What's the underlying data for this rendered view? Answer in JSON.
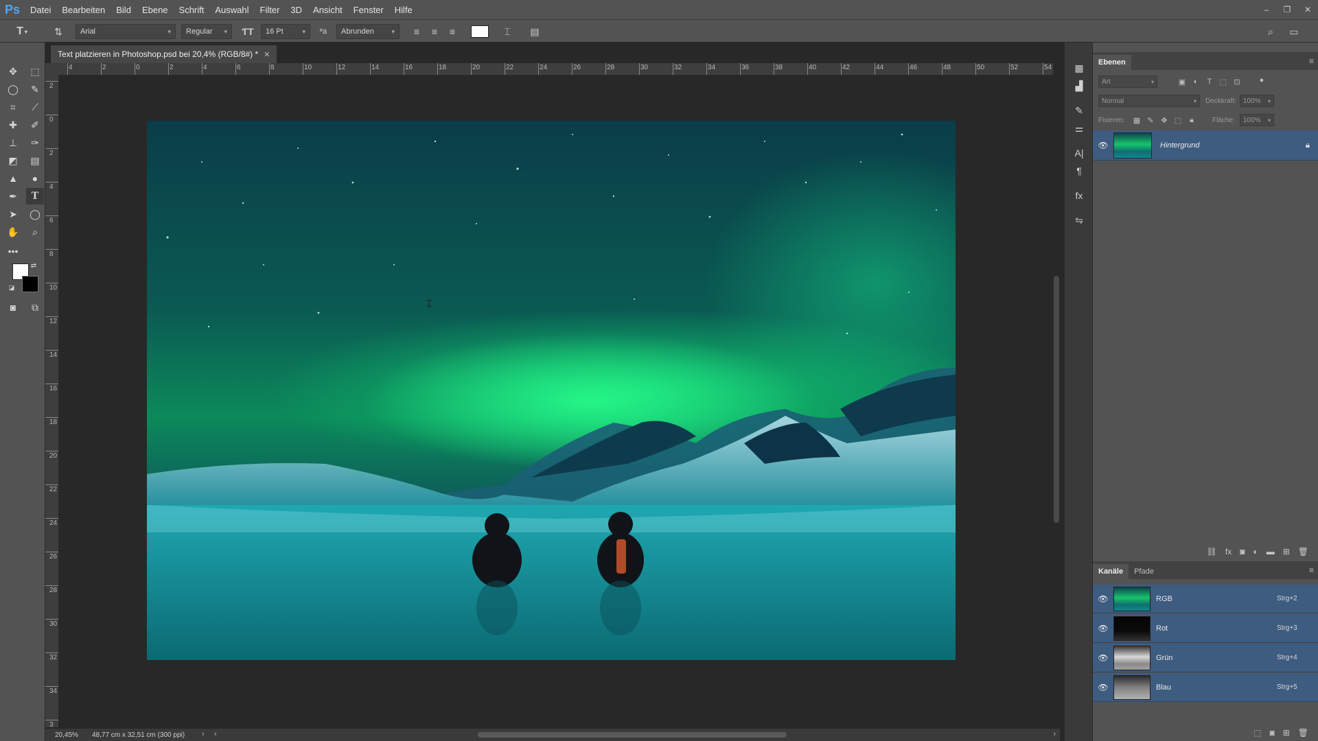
{
  "app": {
    "logo": "Ps"
  },
  "menubar": {
    "items": [
      "Datei",
      "Bearbeiten",
      "Bild",
      "Ebene",
      "Schrift",
      "Auswahl",
      "Filter",
      "3D",
      "Ansicht",
      "Fenster",
      "Hilfe"
    ],
    "window_controls": [
      "–",
      "❐",
      "✕"
    ]
  },
  "options": {
    "tool_glyph": "T",
    "font_family": "Arial",
    "font_style": "Regular",
    "font_size": "16 Pt",
    "antialias_glyph": "ªa",
    "antialias": "Abrunden",
    "text_color": "#ffffff"
  },
  "document": {
    "tab_title": "Text platzieren in Photoshop.psd bei 20,4% (RGB/8#) *",
    "close_glyph": "✕"
  },
  "ruler": {
    "top_labels": [
      "4",
      "2",
      "0",
      "2",
      "4",
      "6",
      "8",
      "10",
      "12",
      "14",
      "16",
      "18",
      "20",
      "22",
      "24",
      "26",
      "28",
      "30",
      "32",
      "34",
      "36",
      "38",
      "40",
      "42",
      "44",
      "46",
      "48",
      "50",
      "52",
      "54"
    ],
    "left_labels": [
      "2",
      "0",
      "2",
      "4",
      "6",
      "8",
      "10",
      "12",
      "14",
      "16",
      "18",
      "20",
      "22",
      "24",
      "26",
      "28",
      "30",
      "32",
      "34",
      "3"
    ]
  },
  "status": {
    "zoom": "20,45%",
    "doc_info": "48,77 cm x 32,51 cm (300 ppi)"
  },
  "layers_panel": {
    "tab": "Ebenen",
    "filter_placeholder": "Art",
    "blend_mode": "Normal",
    "opacity_label": "Deckkraft:",
    "opacity_value": "100%",
    "lock_label": "Fixieren:",
    "fill_label": "Fläche:",
    "fill_value": "100%",
    "layers": [
      {
        "name": "Hintergrund",
        "visible": true,
        "locked": true
      }
    ]
  },
  "channels_panel": {
    "tabs": [
      "Kanäle",
      "Pfade"
    ],
    "channels": [
      {
        "name": "RGB",
        "shortcut": "Strg+2"
      },
      {
        "name": "Rot",
        "shortcut": "Strg+3"
      },
      {
        "name": "Grün",
        "shortcut": "Strg+4"
      },
      {
        "name": "Blau",
        "shortcut": "Strg+5"
      }
    ]
  },
  "colors": {
    "foreground": "#ffffff",
    "background": "#000000",
    "selection_blue": "#3e5b80"
  }
}
